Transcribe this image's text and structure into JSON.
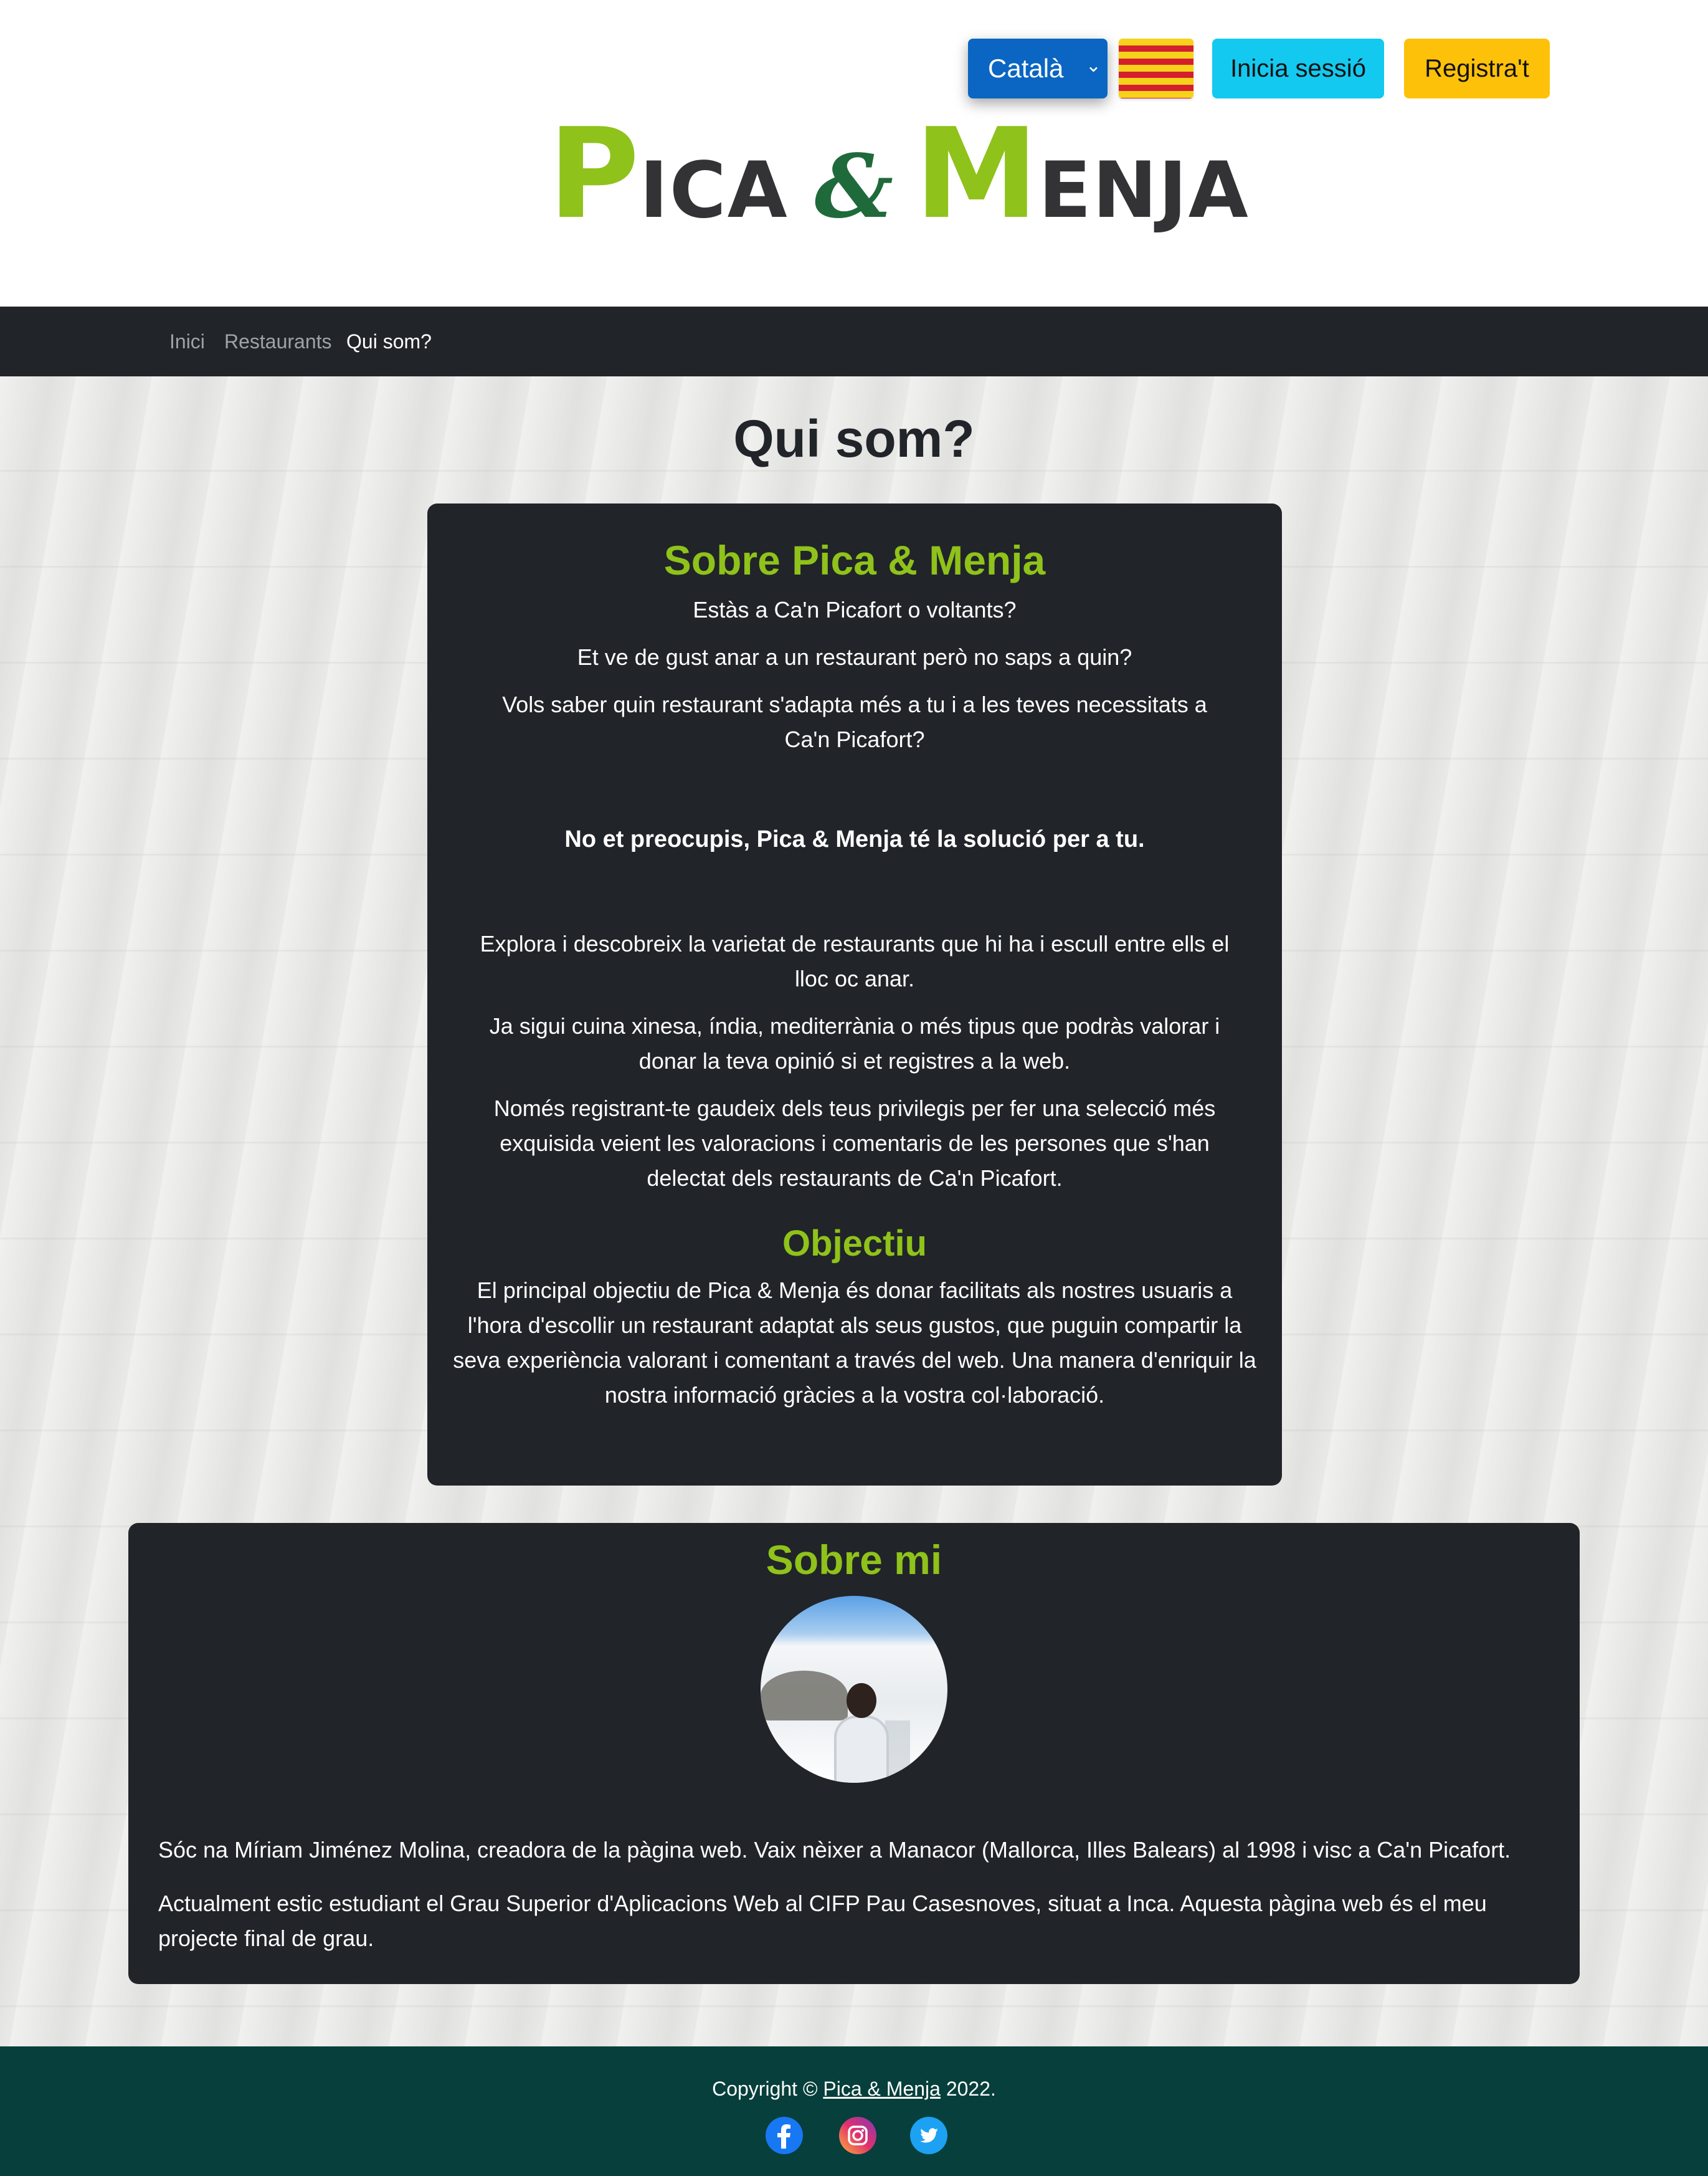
{
  "header": {
    "language": {
      "selected": "Català",
      "chevron": "chevron-down-icon"
    },
    "flag": "catalan-flag-icon",
    "login_label": "Inicia sessió",
    "register_label": "Registra't",
    "logo": {
      "p": "P",
      "ica": "ICA",
      "amp": "&",
      "m": "M",
      "enja": "ENJA"
    }
  },
  "nav": {
    "items": [
      {
        "label": "Inici"
      },
      {
        "label": "Restaurants"
      },
      {
        "label": "Qui som?"
      }
    ]
  },
  "main": {
    "title": "Qui som?",
    "about": {
      "heading": "Sobre Pica & Menja",
      "paragraphs": [
        "Estàs a Ca'n Picafort o voltants?",
        "Et ve de gust anar a un restaurant però no saps a quin?",
        "Vols saber quin restaurant s'adapta més a tu i a les teves necessitats a Ca'n Picafort?"
      ],
      "highlight": "No et preocupis, Pica & Menja té la solució per a tu.",
      "paragraphs2": [
        "Explora i descobreix la varietat de restaurants que hi ha i escull entre ells el lloc oc anar.",
        "Ja sigui cuina xinesa, índia, mediterrània o més tipus que podràs valorar i donar la teva opinió si et registres a la web.",
        "Només registrant-te gaudeix dels teus privilegis per fer una selecció més exquisida veient les valoracions i comentaris de les persones que s'han delectat dels restaurants de Ca'n Picafort."
      ],
      "objective_heading": "Objectiu",
      "objective_text": "El principal objectiu de Pica & Menja és donar facilitats als nostres usuaris a l'hora d'escollir un restaurant adaptat als seus gustos, que puguin compartir la seva experiència valorant i comentant a través del web. Una manera d'enriquir la nostra informació gràcies a la vostra col·laboració."
    },
    "me": {
      "heading": "Sobre mi",
      "paragraphs": [
        "Sóc na Míriam Jiménez Molina, creadora de la pàgina web. Vaix nèixer a Manacor (Mallorca, Illes Balears) al 1998 i visc a Ca'n Picafort.",
        "Actualment estic estudiant el Grau Superior d'Aplicacions Web al CIFP Pau Casesnoves, situat a Inca. Aquesta pàgina web és el meu projecte final de grau."
      ]
    }
  },
  "footer": {
    "copyright_prefix": "Copyright © ",
    "copyright_link": "Pica & Menja",
    "copyright_suffix": " 2022.",
    "social": [
      "facebook-icon",
      "instagram-icon",
      "twitter-icon"
    ]
  },
  "colors": {
    "brand_green": "#8fc21a",
    "dark": "#212429",
    "footer": "#063f3b",
    "login": "#13c9f0",
    "register": "#fdc10a",
    "select": "#0a66c2"
  }
}
